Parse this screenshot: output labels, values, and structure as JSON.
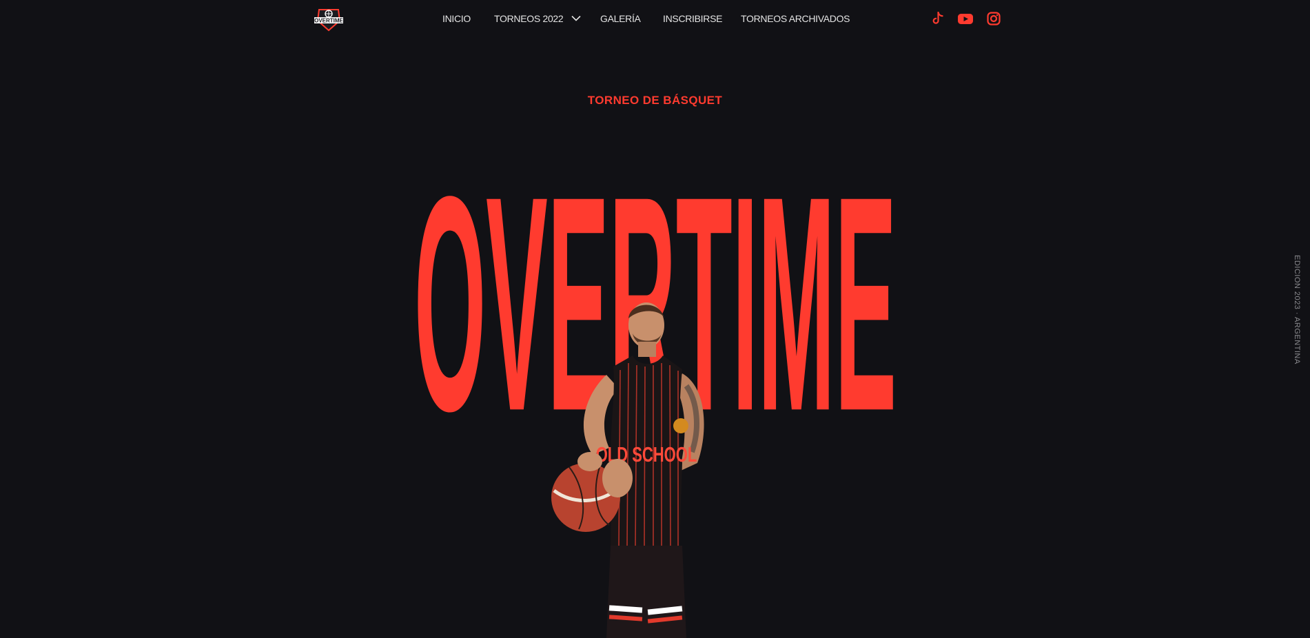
{
  "brand": {
    "logo_text": "OVERTIME",
    "accent_color": "#ff3b2f",
    "background_color": "#111115"
  },
  "nav": {
    "items": [
      {
        "label": "INICIO"
      },
      {
        "label": "TORNEOS 2022",
        "has_dropdown": true
      },
      {
        "label": "GALERÍA"
      },
      {
        "label": "INSCRIBIRSE"
      },
      {
        "label": "TORNEOS ARCHIVADOS"
      }
    ]
  },
  "social": [
    {
      "name": "tiktok-icon"
    },
    {
      "name": "youtube-icon"
    },
    {
      "name": "instagram-icon"
    }
  ],
  "hero": {
    "eyebrow": "TORNEO DE BÁSQUET",
    "title": "OVERTIME",
    "player_jersey_text": "OLD SCHOOL",
    "side_note": "EDICION 2023 · ARGENTINA"
  }
}
